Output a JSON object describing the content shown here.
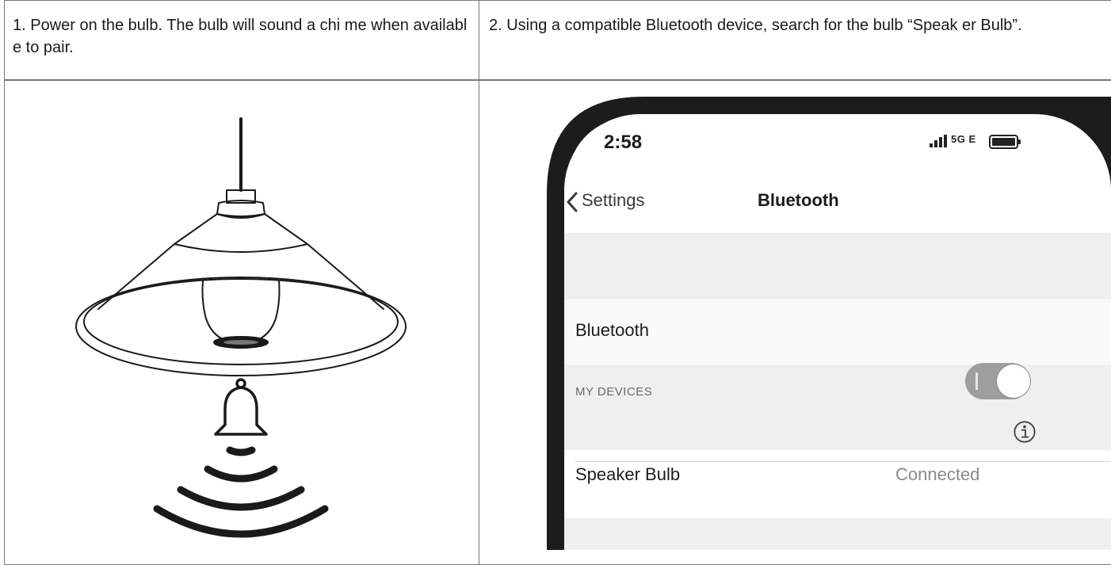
{
  "steps": [
    {
      "text": "1. Power on the bulb. The bulb will sound a chi me when available to pair."
    },
    {
      "text": "2. Using a compatible Bluetooth device, search for the bulb “Speak er Bulb”."
    }
  ],
  "phone": {
    "status_time": "2:58",
    "status_network": "5G E",
    "nav_back_label": "Settings",
    "nav_title": "Bluetooth",
    "bluetooth_row_label": "Bluetooth",
    "toggle_on": true,
    "section_header": "MY DEVICES",
    "device_name": "Speaker Bulb",
    "device_status": "Connected"
  },
  "icons": {
    "illustration": "pendant-lamp-icon",
    "chime": "bell-icon",
    "sound": "sound-waves-icon",
    "back": "chevron-left-icon",
    "info": "info-circle-icon",
    "signal": "signal-bars-icon",
    "battery": "battery-icon"
  }
}
